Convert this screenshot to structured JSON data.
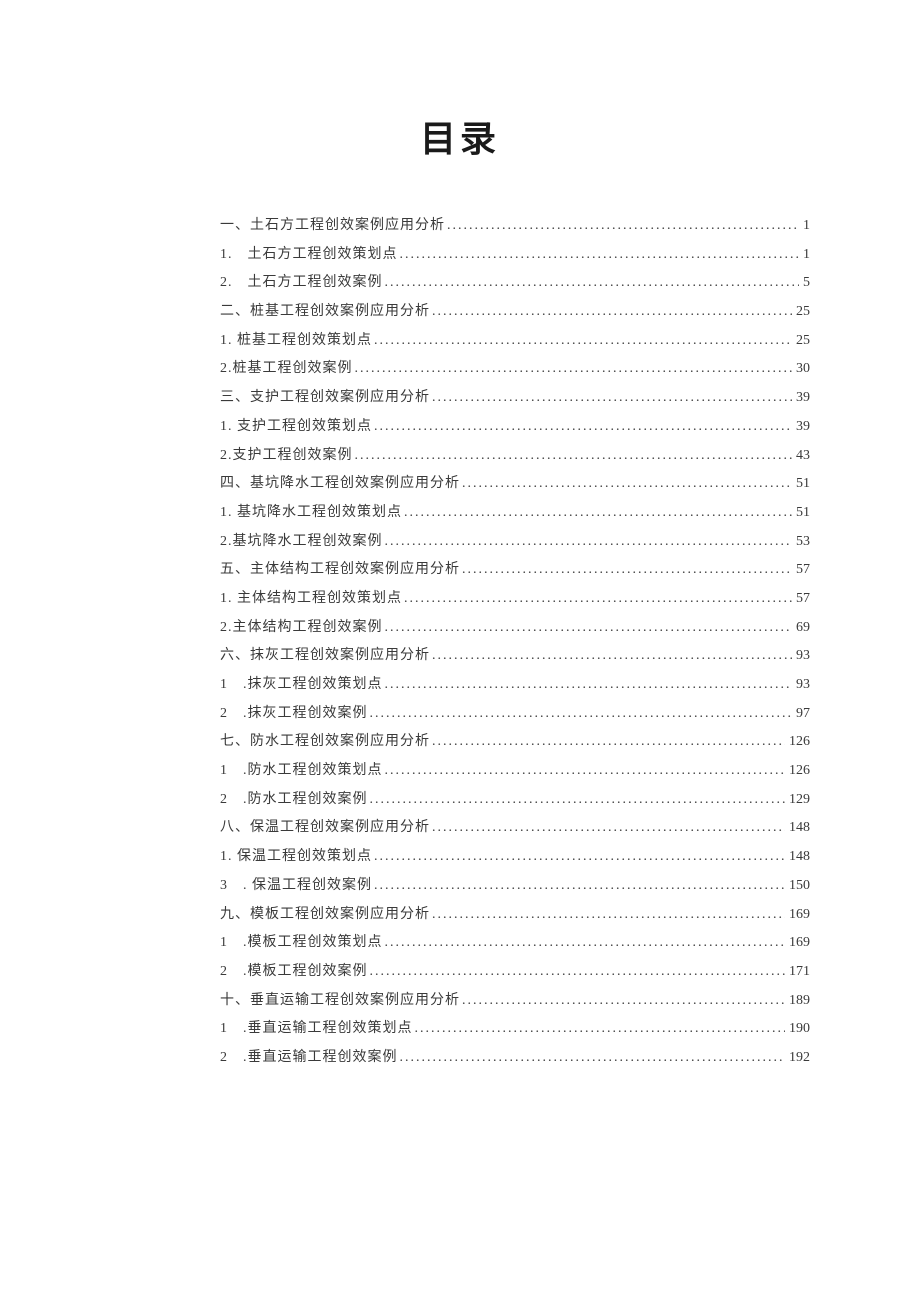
{
  "title": "目录",
  "toc": [
    {
      "label": "一、土石方工程创效案例应用分析",
      "page": "1"
    },
    {
      "label": "1. 土石方工程创效策划点",
      "page": "1"
    },
    {
      "label": "2. 土石方工程创效案例",
      "page": "5"
    },
    {
      "label": "二、桩基工程创效案例应用分析",
      "page": "25"
    },
    {
      "label": "1. 桩基工程创效策划点",
      "page": "25"
    },
    {
      "label": "2.桩基工程创效案例",
      "page": "30"
    },
    {
      "label": "三、支护工程创效案例应用分析",
      "page": "39"
    },
    {
      "label": "1. 支护工程创效策划点",
      "page": "39"
    },
    {
      "label": "2.支护工程创效案例",
      "page": "43"
    },
    {
      "label": "四、基坑降水工程创效案例应用分析",
      "page": "51"
    },
    {
      "label": "1. 基坑降水工程创效策划点",
      "page": "51"
    },
    {
      "label": "2.基坑降水工程创效案例",
      "page": "53"
    },
    {
      "label": "五、主体结构工程创效案例应用分析",
      "page": "57"
    },
    {
      "label": "1. 主体结构工程创效策划点",
      "page": "57"
    },
    {
      "label": "2.主体结构工程创效案例",
      "page": "69"
    },
    {
      "label": "六、抹灰工程创效案例应用分析",
      "page": "93"
    },
    {
      "label": "1 .抹灰工程创效策划点",
      "page": "93"
    },
    {
      "label": "2 .抹灰工程创效案例",
      "page": "97"
    },
    {
      "label": "七、防水工程创效案例应用分析",
      "page": "126"
    },
    {
      "label": "1 .防水工程创效策划点",
      "page": "126"
    },
    {
      "label": "2 .防水工程创效案例",
      "page": "129"
    },
    {
      "label": "八、保温工程创效案例应用分析",
      "page": "148"
    },
    {
      "label": "1. 保温工程创效策划点",
      "page": "148"
    },
    {
      "label": "3 . 保温工程创效案例",
      "page": "150"
    },
    {
      "label": "九、模板工程创效案例应用分析",
      "page": "169"
    },
    {
      "label": "1 .模板工程创效策划点",
      "page": "169"
    },
    {
      "label": "2 .模板工程创效案例",
      "page": "171"
    },
    {
      "label": "十、垂直运输工程创效案例应用分析",
      "page": "189"
    },
    {
      "label": "1 .垂直运输工程创效策划点",
      "page": "190"
    },
    {
      "label": "2 .垂直运输工程创效案例",
      "page": "192"
    }
  ]
}
